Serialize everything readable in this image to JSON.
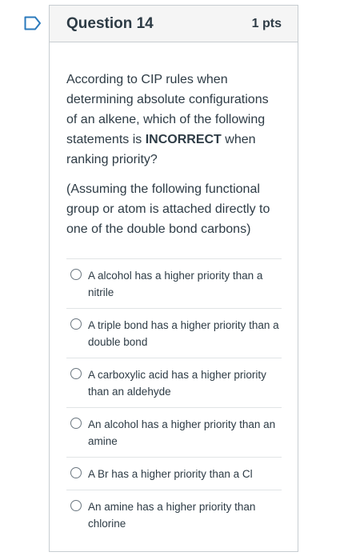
{
  "question": {
    "title": "Question 14",
    "points": "1 pts",
    "paragraph1_pre": "According to CIP rules when determining absolute configurations of an alkene, which of the following statements is ",
    "paragraph1_bold": "INCORRECT",
    "paragraph1_post": " when ranking priority?",
    "paragraph2": "(Assuming the following functional group or atom is attached directly to one of the double bond carbons)"
  },
  "answers": [
    "A alcohol has a higher priority than a nitrile",
    "A triple bond has a higher priority than a double bond",
    "A carboxylic acid has a higher priority than an aldehyde",
    "An alcohol has a higher priority than an amine",
    "A Br has a higher priority than a Cl",
    "An amine has a higher priority than chlorine"
  ],
  "colors": {
    "text": "#2d3b45",
    "header_bg": "#f5f5f5",
    "border": "#c7cdd1",
    "flag": "#2b7abc"
  },
  "icons": {
    "flag": "bookmark-flag-icon",
    "radio": "radio-button-icon"
  }
}
